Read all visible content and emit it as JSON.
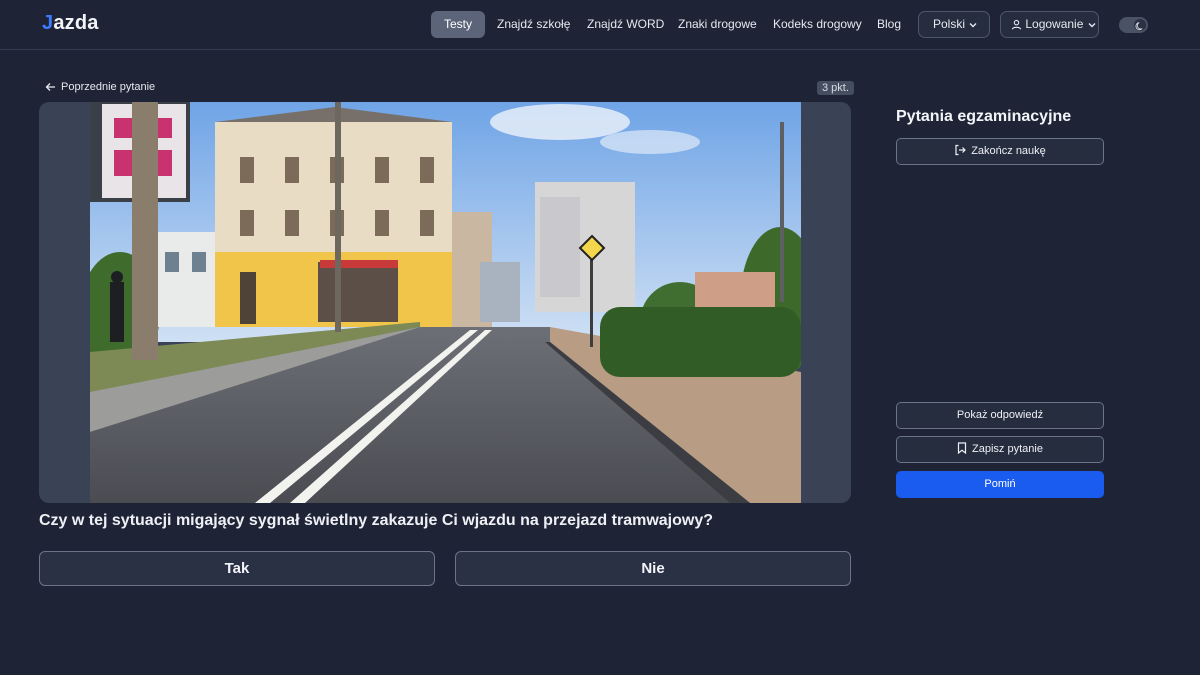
{
  "header": {
    "logo": {
      "mark": "J",
      "text": "azda"
    },
    "nav": [
      "Testy",
      "Znajdź szkołę",
      "Znajdź WORD",
      "Znaki drogowe",
      "Kodeks drogowy",
      "Blog"
    ],
    "language": "Polski",
    "login": "Logowanie",
    "theme_toggle_icon": "moon-icon"
  },
  "main": {
    "back_link": "Poprzednie pytanie",
    "points": "3 pkt.",
    "question": "Czy w tej sytuacji migający sygnał świetlny zakazuje Ci wjazdu na przejazd tramwajowy?",
    "answers": [
      "Tak",
      "Nie"
    ]
  },
  "sidebar": {
    "title": "Pytania egzaminacyjne",
    "finish": "Zakończ naukę",
    "show_answer": "Pokaż odpowiedź",
    "save_question": "Zapisz pytanie",
    "skip": "Pomiń"
  },
  "colors": {
    "background": "#1e2435",
    "accent": "#1a5cf0",
    "nav_active": "#5b6479"
  }
}
